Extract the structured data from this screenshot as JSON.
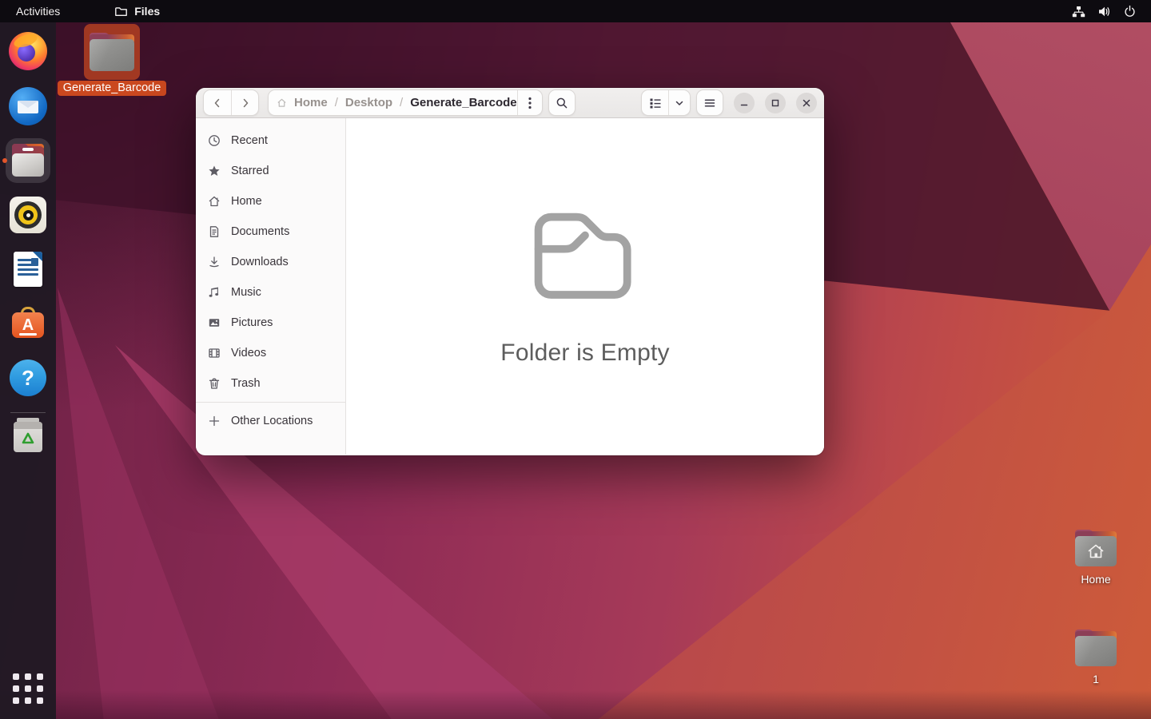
{
  "topbar": {
    "activities_label": "Activities",
    "focused_app_label": "Files",
    "status_icons": [
      "network-wired-icon",
      "volume-icon",
      "power-icon"
    ]
  },
  "dock": {
    "items": [
      {
        "name": "firefox"
      },
      {
        "name": "thunderbird"
      },
      {
        "name": "files",
        "active": true
      },
      {
        "name": "rhythmbox"
      },
      {
        "name": "libreoffice-writer"
      },
      {
        "name": "ubuntu-software"
      },
      {
        "name": "help"
      },
      {
        "name": "trash"
      },
      {
        "name": "app-grid"
      }
    ]
  },
  "desktop": {
    "icons": [
      {
        "label": "Generate_Barcode",
        "selected": true
      },
      {
        "label": "Home",
        "selected": false
      },
      {
        "label": "1",
        "selected": false
      }
    ]
  },
  "window": {
    "header": {
      "separator": "/",
      "breadcrumbs": [
        {
          "label": "Home",
          "current": false
        },
        {
          "label": "Desktop",
          "current": false
        },
        {
          "label": "Generate_Barcode",
          "current": true
        }
      ]
    },
    "sidebar": {
      "items": [
        {
          "label": "Recent",
          "icon": "recent-clock-icon"
        },
        {
          "label": "Starred",
          "icon": "star-icon"
        },
        {
          "label": "Home",
          "icon": "home-icon"
        },
        {
          "label": "Documents",
          "icon": "document-icon"
        },
        {
          "label": "Downloads",
          "icon": "download-icon"
        },
        {
          "label": "Music",
          "icon": "music-note-icon"
        },
        {
          "label": "Pictures",
          "icon": "picture-icon"
        },
        {
          "label": "Videos",
          "icon": "video-icon"
        },
        {
          "label": "Trash",
          "icon": "trash-icon"
        }
      ],
      "other_locations": {
        "label": "Other Locations",
        "icon": "plus-icon"
      }
    },
    "empty_state": {
      "title": "Folder is Empty"
    }
  },
  "colors": {
    "accent_orange": "#E95420",
    "selection_orange": "#DE501E",
    "topbar_bg": "#0D0B10",
    "headerbar_bg": "#EBE9E8",
    "empty_text": "#5D5D5D"
  }
}
